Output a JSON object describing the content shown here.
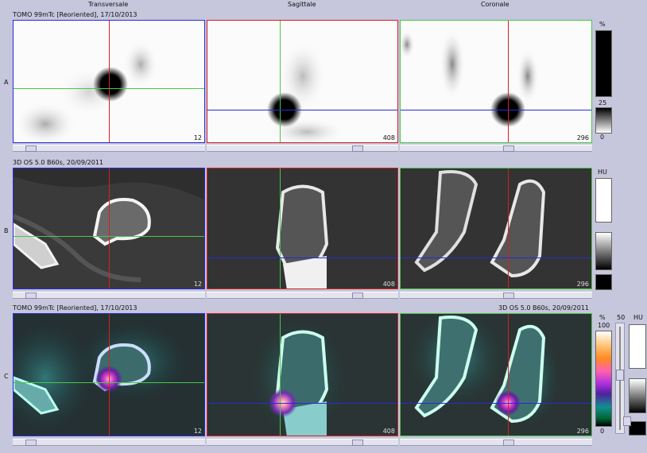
{
  "columns": {
    "transversal": "Transversale",
    "sagittal": "Sagittale",
    "coronal": "Coronale"
  },
  "rows": {
    "A": {
      "label": "A",
      "series": "TOMO 99mTc [Reoriented], 17/10/2013",
      "scale_unit": "%",
      "scale_mid": "25",
      "scale_min": "0"
    },
    "B": {
      "label": "B",
      "series": "3D  OS  5.0  B60s, 20/09/2011",
      "scale_unit": "HU"
    },
    "C": {
      "label": "C",
      "series_left": "TOMO 99mTc [Reoriented], 17/10/2013",
      "series_right": "3D  OS  5.0  B60s, 20/09/2011",
      "scale_unit": "%",
      "scale_max": "100",
      "scale_min": "0",
      "window_value": "50",
      "hu_unit": "HU"
    }
  },
  "slices": {
    "transversal": "12",
    "sagittal": "408",
    "coronal": "296"
  },
  "colors": {
    "crosshair_vertical": "#d82020",
    "crosshair_horizontal_transversal": "#48c848",
    "crosshair_sagittal_v": "#48c848",
    "crosshair_blue": "#2a2ad8",
    "panel_blue": "#2a2ad8",
    "panel_red": "#d82020",
    "panel_green": "#48c848"
  }
}
